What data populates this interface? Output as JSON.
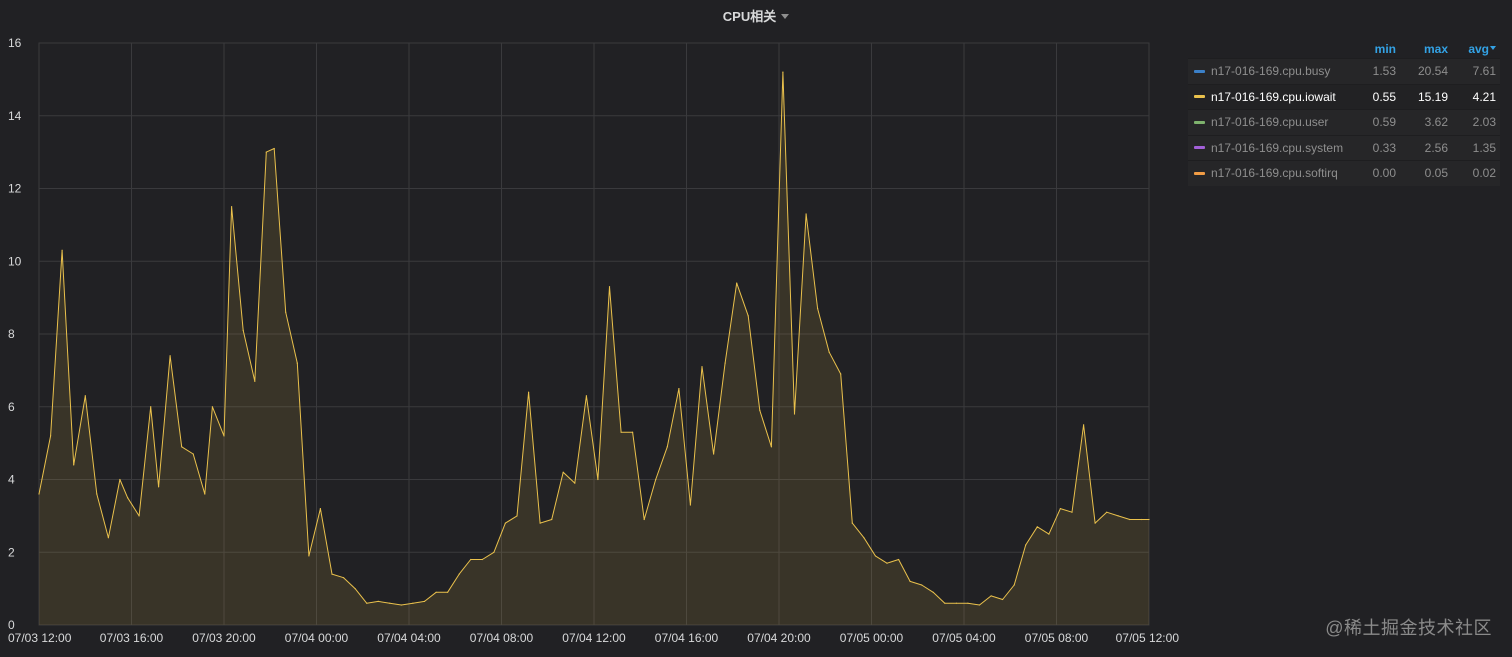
{
  "panel": {
    "title": "CPU相关"
  },
  "legend": {
    "headers": {
      "min": "min",
      "max": "max",
      "avg": "avg"
    },
    "rows": [
      {
        "name": "n17-016-169.cpu.busy",
        "color": "#3b80c8",
        "min": "1.53",
        "max": "20.54",
        "avg": "7.61",
        "active": false
      },
      {
        "name": "n17-016-169.cpu.iowait",
        "color": "#eac14c",
        "min": "0.55",
        "max": "15.19",
        "avg": "4.21",
        "active": true
      },
      {
        "name": "n17-016-169.cpu.user",
        "color": "#7eb26d",
        "min": "0.59",
        "max": "3.62",
        "avg": "2.03",
        "active": false
      },
      {
        "name": "n17-016-169.cpu.system",
        "color": "#a260d8",
        "min": "0.33",
        "max": "2.56",
        "avg": "1.35",
        "active": false
      },
      {
        "name": "n17-016-169.cpu.softirq",
        "color": "#f19c45",
        "min": "0.00",
        "max": "0.05",
        "avg": "0.02",
        "active": false
      }
    ]
  },
  "watermark": "@稀土掘金技术社区",
  "chart_data": {
    "type": "area",
    "title": "CPU相关",
    "xlabel": "",
    "ylabel": "",
    "x_unit": "hours since 07/03 12:00",
    "xlim": [
      0,
      48
    ],
    "ylim": [
      0,
      16
    ],
    "grid": true,
    "legend_position": "right",
    "x_ticks": [
      {
        "value": 0,
        "label": "07/03 12:00"
      },
      {
        "value": 4,
        "label": "07/03 16:00"
      },
      {
        "value": 8,
        "label": "07/03 20:00"
      },
      {
        "value": 12,
        "label": "07/04 00:00"
      },
      {
        "value": 16,
        "label": "07/04 04:00"
      },
      {
        "value": 20,
        "label": "07/04 08:00"
      },
      {
        "value": 24,
        "label": "07/04 12:00"
      },
      {
        "value": 28,
        "label": "07/04 16:00"
      },
      {
        "value": 32,
        "label": "07/04 20:00"
      },
      {
        "value": 36,
        "label": "07/05 00:00"
      },
      {
        "value": 40,
        "label": "07/05 04:00"
      },
      {
        "value": 44,
        "label": "07/05 08:00"
      },
      {
        "value": 48,
        "label": "07/05 12:00"
      }
    ],
    "y_ticks": [
      0,
      2,
      4,
      6,
      8,
      10,
      12,
      14,
      16
    ],
    "series": [
      {
        "name": "n17-016-169.cpu.iowait",
        "color": "#eac14c",
        "x": [
          0,
          0.5,
          1,
          1.5,
          2,
          2.5,
          3,
          3.5,
          3.83,
          4.33,
          4.83,
          5.17,
          5.67,
          6.17,
          6.67,
          7.17,
          7.5,
          8,
          8.33,
          8.83,
          9.33,
          9.83,
          10.17,
          10.67,
          11.17,
          11.67,
          12.17,
          12.67,
          13.17,
          13.67,
          14.17,
          14.67,
          15.17,
          15.67,
          16.17,
          16.67,
          17.17,
          17.67,
          18.17,
          18.67,
          19.17,
          19.67,
          20.17,
          20.67,
          21.17,
          21.67,
          22.17,
          22.67,
          23.17,
          23.67,
          24.17,
          24.67,
          25.17,
          25.67,
          26.17,
          26.67,
          27.17,
          27.67,
          28.17,
          28.67,
          29.17,
          29.67,
          30.17,
          30.67,
          31.17,
          31.67,
          32.17,
          32.67,
          33.17,
          33.67,
          34.17,
          34.67,
          35.17,
          35.67,
          36.17,
          36.67,
          37.17,
          37.67,
          38.17,
          38.67,
          39.17,
          39.67,
          40.17,
          40.67,
          41.17,
          41.67,
          42.17,
          42.67,
          43.17,
          43.67,
          44.17,
          44.67,
          45.17,
          45.67,
          46.17,
          46.67,
          47.17,
          47.67,
          48
        ],
        "values": [
          3.6,
          5.2,
          10.3,
          4.4,
          6.3,
          3.6,
          2.4,
          4.0,
          3.5,
          3.0,
          6.0,
          3.8,
          7.4,
          4.9,
          4.7,
          3.6,
          6.0,
          5.2,
          11.5,
          8.1,
          6.7,
          13.0,
          13.1,
          8.6,
          7.2,
          1.9,
          3.2,
          1.4,
          1.3,
          1.0,
          0.6,
          0.65,
          0.6,
          0.55,
          0.6,
          0.65,
          0.9,
          0.9,
          1.4,
          1.8,
          1.8,
          2.0,
          2.8,
          3.0,
          6.4,
          2.8,
          2.9,
          4.2,
          3.9,
          6.3,
          4.0,
          9.3,
          5.3,
          5.3,
          2.9,
          4.0,
          4.9,
          6.5,
          3.3,
          7.1,
          4.7,
          7.2,
          9.4,
          8.5,
          5.9,
          4.9,
          15.2,
          5.8,
          11.3,
          8.7,
          7.5,
          6.9,
          2.8,
          2.4,
          1.9,
          1.7,
          1.8,
          1.2,
          1.1,
          0.9,
          0.6,
          0.6,
          0.6,
          0.55,
          0.8,
          0.7,
          1.1,
          2.2,
          2.7,
          2.5,
          3.2,
          3.1,
          5.5,
          2.8,
          3.1,
          3.0,
          2.9,
          2.9,
          2.9
        ]
      }
    ]
  }
}
